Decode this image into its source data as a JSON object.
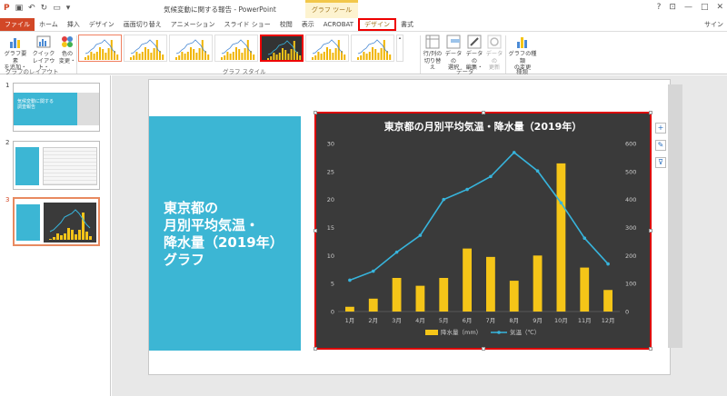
{
  "app": {
    "title": "気候変動に関する報告 - PowerPoint",
    "context_header": "グラフ ツール",
    "signin": "サイン",
    "window_controls": [
      "?",
      "⊡",
      "—",
      "□",
      "✕"
    ]
  },
  "tabs": [
    {
      "label": "ファイル",
      "kind": "file"
    },
    {
      "label": "ホーム"
    },
    {
      "label": "挿入"
    },
    {
      "label": "デザイン"
    },
    {
      "label": "画面切り替え"
    },
    {
      "label": "アニメーション"
    },
    {
      "label": "スライド ショー"
    },
    {
      "label": "校閲"
    },
    {
      "label": "表示"
    },
    {
      "label": "ACROBAT"
    },
    {
      "label": "デザイン",
      "kind": "active-ctx"
    },
    {
      "label": "書式"
    }
  ],
  "ribbon": {
    "add_element": "グラフ要素\nを追加・",
    "quick_layout": "クイック\nレイアウト・",
    "change_colors": "色の\n変更・",
    "group_layouts": "グラフのレイアウト",
    "group_styles": "グラフ スタイル",
    "switch_row_col": "行/列の\n切り替え",
    "select_data": "データの\n選択",
    "edit_data": "データの\n編集・",
    "refresh_data": "データの\n更新",
    "group_data": "データ",
    "change_chart_type": "グラフの種類\nの変更",
    "group_type": "種類"
  },
  "slides": [
    {
      "num": "1",
      "text": "気候変動に関する\n調査報告"
    },
    {
      "num": "2",
      "text": ""
    },
    {
      "num": "3",
      "text": ""
    }
  ],
  "slide": {
    "title": "東京都の\n月別平均気温・\n降水量（2019年）\nグラフ"
  },
  "side_buttons": [
    "+",
    "✎",
    "⊽"
  ],
  "colors": {
    "file_tab": "#d24726",
    "slide_title_box": "#3cb6d4",
    "bar": "#f5c518",
    "line": "#37b4dc",
    "chart_bg": "#3a3a3a"
  },
  "chart_data": {
    "type": "bar+line",
    "title": "東京都の月別平均気温・降水量（2019年）",
    "categories": [
      "1月",
      "2月",
      "3月",
      "4月",
      "5月",
      "6月",
      "7月",
      "8月",
      "9月",
      "10月",
      "11月",
      "12月"
    ],
    "series": [
      {
        "name": "降水量（mm）",
        "type": "bar",
        "axis": "right",
        "values": [
          17,
          46,
          120,
          92,
          120,
          225,
          195,
          110,
          200,
          529,
          157,
          77
        ]
      },
      {
        "name": "気温（℃）",
        "type": "line",
        "axis": "left",
        "values": [
          5.6,
          7.2,
          10.6,
          13.6,
          20.0,
          21.8,
          24.1,
          28.4,
          25.1,
          19.4,
          13.1,
          8.5
        ]
      }
    ],
    "y_left": {
      "min": 0,
      "max": 30,
      "ticks": [
        0,
        5,
        10,
        15,
        20,
        25,
        30
      ]
    },
    "y_right": {
      "min": 0,
      "max": 600,
      "ticks": [
        0,
        100,
        200,
        300,
        400,
        500,
        600
      ]
    },
    "legend": "bottom",
    "grid": false
  }
}
